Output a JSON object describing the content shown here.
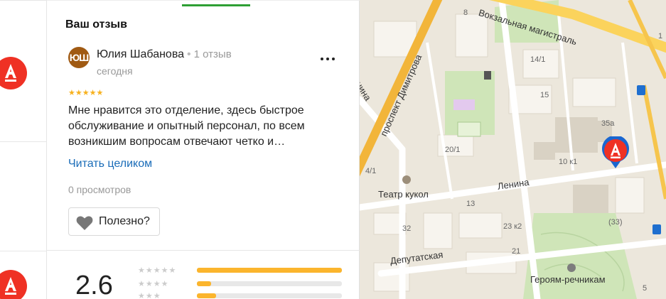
{
  "section_title": "Ваш отзыв",
  "review": {
    "avatar_initials": "ЮШ",
    "author": "Юлия Шабанова",
    "reviews_count": "1 отзыв",
    "date": "сегодня",
    "stars": "★★★★★",
    "rating_value": 5,
    "text": "Мне нравится это отделение, здесь быстрое обслуживание и опытный персонал, по всем возникшим вопросам отвечают четко и…",
    "read_more": "Читать целиком",
    "views": "0 просмотров",
    "useful_label": "Полезно?"
  },
  "rating": {
    "average": "2.6",
    "distribution": [
      {
        "stars": "★★★★★",
        "fraction": 1.0
      },
      {
        "stars": "★★★★",
        "fraction": 0.1
      },
      {
        "stars": "★★★",
        "fraction": 0.13
      }
    ]
  },
  "brand": {
    "logo_letter": "А",
    "color": "#ef3124"
  },
  "map": {
    "streets": [
      "Вокзальная магистраль",
      "проспект Димитрова",
      "Ленина",
      "Депутатская",
      "Театр кукол",
      "Героям-речникам"
    ],
    "house_numbers": [
      "8",
      "14/1",
      "15",
      "20/1",
      "4/1",
      "13",
      "32",
      "23 к2",
      "21",
      "10 к1",
      "35а",
      "(33)",
      "5",
      "1"
    ],
    "partial_labels": [
      "нина"
    ]
  }
}
